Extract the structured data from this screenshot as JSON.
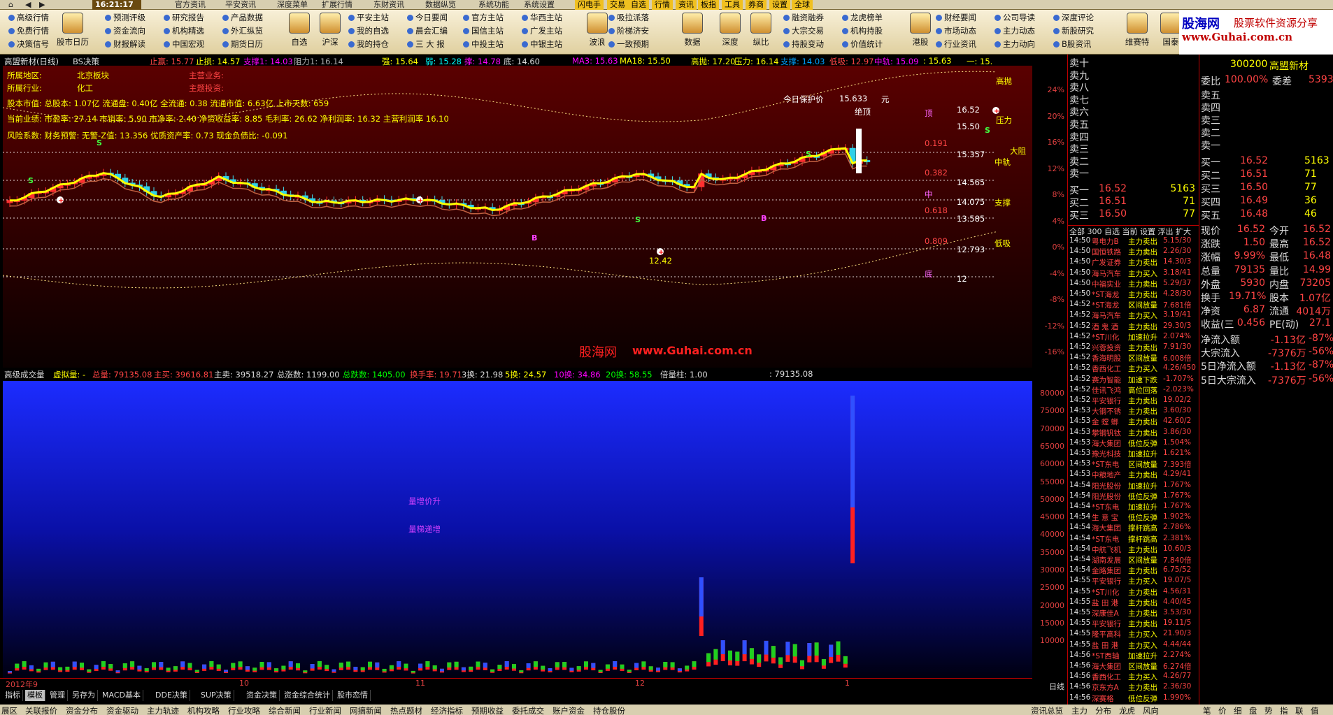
{
  "menu": {
    "clock": "16:21:17",
    "items": [
      "官方资讯",
      "平安资讯",
      "深度菜单",
      "扩展行情",
      "东财资讯",
      "数据纵览",
      "系统功能",
      "系统设置",
      "闪电手",
      "交易",
      "自选",
      "行情",
      "资讯",
      "板指",
      "工具",
      "券商",
      "设置",
      "全球"
    ]
  },
  "toolbar": {
    "cols": [
      {
        "items": [
          "高级行情",
          "免费行情",
          "决策信号"
        ]
      },
      {
        "items": [
          "预测评级",
          "资金流向",
          "财报解读"
        ]
      },
      {
        "items": [
          "研究报告",
          "机构精选",
          "中国宏观"
        ]
      },
      {
        "items": [
          "产品数据",
          "外汇纵览",
          "期货日历"
        ]
      },
      {
        "items": [
          "平安主站",
          "我的自选",
          "我的持仓"
        ]
      },
      {
        "items": [
          "今日要闻",
          "晨会汇编",
          "三 大 报"
        ]
      },
      {
        "items": [
          "官方主站",
          "国信主站",
          "中投主站"
        ]
      },
      {
        "items": [
          "华西主站",
          "广发主站",
          "中银主站"
        ]
      },
      {
        "items": [
          "吸拉派落",
          "阶梯济安",
          "一致预期"
        ]
      },
      {
        "items": [
          "融资融券",
          "大宗交易",
          "持股变动"
        ]
      },
      {
        "items": [
          "龙虎榜单",
          "机构持股",
          "价值统计"
        ]
      },
      {
        "items": [
          "财经要闻",
          "市场动态",
          "行业资讯"
        ]
      },
      {
        "items": [
          "公司导读",
          "主力动态",
          "主力动向"
        ]
      },
      {
        "items": [
          "深度评论",
          "新股研究",
          "B股资讯"
        ]
      }
    ],
    "bigs": [
      "股市日历",
      "自选",
      "沪深",
      "波浪",
      "数据",
      "深度",
      "纵比",
      "港股",
      "维赛特",
      "国泰"
    ],
    "extra": [
      "财经日历",
      "千股千评"
    ]
  },
  "brand": {
    "line1": "股海网",
    "line2": "股票软件资源分享",
    "line3": "www.Guhai.com.cn"
  },
  "infobar1": [
    {
      "t": "高盟新材(日线)",
      "c": "#dddddd"
    },
    {
      "t": "BS决策",
      "c": "#dddddd"
    },
    {
      "t": "止赢: 15.77",
      "c": "#ff4444"
    },
    {
      "t": "止损: 14.57",
      "c": "#ffff00"
    },
    {
      "t": "支撑1: 14.03",
      "c": "#ff00ff"
    },
    {
      "t": "阻力1: 16.14",
      "c": "#aaaaaa"
    },
    {
      "t": "强: 15.64",
      "c": "#ffff00"
    },
    {
      "t": "弱: 15.28",
      "c": "#00ffff"
    },
    {
      "t": "撑: 14.78",
      "c": "#ff00ff"
    },
    {
      "t": "底: 14.60",
      "c": "#dddddd"
    },
    {
      "t": "MA3: 15.63",
      "c": "#ff00ff"
    },
    {
      "t": "MA18: 15.50",
      "c": "#ffff00"
    },
    {
      "t": "高抛: 17.20",
      "c": "#ffff00"
    },
    {
      "t": "压力: 16.14",
      "c": "#ffff00"
    },
    {
      "t": "支撑: 14.03",
      "c": "#00a0ff"
    },
    {
      "t": "低吸: 12.97",
      "c": "#ff4444"
    },
    {
      "t": "中轨: 15.09",
      "c": "#ff00ff"
    },
    {
      "t": ": 15.63",
      "c": "#ffff00"
    },
    {
      "t": "一: 15.",
      "c": "#ffff00"
    }
  ],
  "fund": {
    "area_label": "所属地区:",
    "area": "北京板块",
    "business_label": "主营业务:",
    "industry_label": "所属行业:",
    "industry": "化工",
    "concept_label": "主题投资:",
    "line1": "股本市值: 总股本: 1.07亿 流通盘: 0.40亿 全流通: 0.38 流通市值: 6.63亿 上市天数: 659",
    "line2": "当前业绩: 市盈率: 27.14 市销率: 5.90 市净率: 2.40 净资收益率: 8.85 毛利率: 26.62 净利润率: 16.32 主营利润率 16.10",
    "line3": "风险系数: 财务预警: 无警-Z值: 13.356 优质资产率: 0.73 现金负债比: -0.091"
  },
  "protect": {
    "label": "今日保护价",
    "value": "15.633",
    "unit": "元",
    "note": "绝顶"
  },
  "chart_labels": {
    "gaopao": "高抛",
    "yali": "压力",
    "dazhu": "大阻",
    "zhonggui": "中轨",
    "zhicheng": "支撑",
    "dixi": "低吸",
    "ding": "顶",
    "zhong": "中",
    "di": "底",
    "low": "12.42",
    "levels": [
      "16.52",
      "15.50",
      "15.357",
      "14.565",
      "14.075",
      "13.585",
      "12.793",
      "12"
    ],
    "fibs": [
      "0.191",
      "0.382",
      "0.618",
      "0.809"
    ],
    "vol_notes": [
      "量增价升",
      "量梯递增"
    ]
  },
  "pct_axis": [
    "24%",
    "20%",
    "16%",
    "12%",
    "8%",
    "4%",
    "0%",
    "-4%",
    "-8%",
    "-12%",
    "-16%"
  ],
  "vol_axis": [
    "80000",
    "75000",
    "70000",
    "65000",
    "60000",
    "55000",
    "50000",
    "45000",
    "40000",
    "35000",
    "30000",
    "25000",
    "20000",
    "15000",
    "10000"
  ],
  "infobar2": [
    {
      "t": "高级成交量",
      "c": "#dddddd"
    },
    {
      "t": "虚拟量: -",
      "c": "#ffff00"
    },
    {
      "t": "总量: 79135.08",
      "c": "#ff4444"
    },
    {
      "t": "主买: 39616.81",
      "c": "#ff4444"
    },
    {
      "t": "主卖: 39518.27",
      "c": "#dddddd"
    },
    {
      "t": "总涨数: 1199.00",
      "c": "#dddddd"
    },
    {
      "t": "总跌数: 1405.00",
      "c": "#00ff00"
    },
    {
      "t": "换手率: 19.71",
      "c": "#ff4444"
    },
    {
      "t": "3换: 21.98",
      "c": "#dddddd"
    },
    {
      "t": "5换: 24.57",
      "c": "#ffff00"
    },
    {
      "t": "10换: 34.86",
      "c": "#ff00ff"
    },
    {
      "t": "20换: 58.55",
      "c": "#00ff00"
    },
    {
      "t": "倍量柱: 1.00",
      "c": "#dddddd"
    },
    {
      "t": ": 79135.08",
      "c": "#dddddd"
    }
  ],
  "xaxis": [
    "2012年9",
    "10",
    "11",
    "12",
    "1"
  ],
  "daily_label": "日线",
  "tabs": [
    "指标",
    "模板",
    "管理",
    "另存为",
    "MACD基本",
    "DDE决策",
    "SUP决策",
    "资金决策",
    "资金综合统计",
    "股市恋情"
  ],
  "status": [
    "展区",
    "关联报价",
    "资金分布",
    "资金驱动",
    "主力轨迹",
    "机构攻略",
    "行业攻略",
    "综合新闻",
    "行业新闻",
    "网摘新闻",
    "热点题材",
    "经济指标",
    "预期收益",
    "委托成交",
    "账户资金",
    "持仓股份",
    "资讯总览",
    "主力",
    "分布",
    "龙虎",
    "风向",
    "笔",
    "价",
    "细",
    "盘",
    "势",
    "指",
    "联",
    "值"
  ],
  "quote": {
    "sells": [
      "卖十",
      "卖九",
      "卖八",
      "卖七",
      "卖六",
      "卖五",
      "卖四",
      "卖三",
      "卖二",
      "卖一"
    ],
    "buys": [
      {
        "l": "买一",
        "p": "16.52",
        "v": "5163"
      },
      {
        "l": "买二",
        "p": "16.51",
        "v": "71"
      },
      {
        "l": "买三",
        "p": "16.50",
        "v": "77"
      }
    ],
    "tabs": "全部 300 自选 当前 设置 浮出 扩大",
    "ticks": [
      [
        "14:50",
        "粤电力B",
        "主力卖出",
        "5.15/30"
      ],
      [
        "14:50",
        "国恒铁路",
        "主力卖出",
        "2.26/30"
      ],
      [
        "14:50",
        "广发证券",
        "主力卖出",
        "14.30/3"
      ],
      [
        "14:50",
        "海马汽车",
        "主力买入",
        "3.18/41"
      ],
      [
        "14:50",
        "中福实业",
        "主力卖出",
        "5.29/37"
      ],
      [
        "14:50",
        "*ST海龙",
        "主力卖出",
        "4.28/30"
      ],
      [
        "14:52",
        "*ST海龙",
        "区间放量",
        "7.681倍"
      ],
      [
        "14:52",
        "海马汽车",
        "主力买入",
        "3.19/41"
      ],
      [
        "14:52",
        "酒 鬼 酒",
        "主力卖出",
        "29.30/3"
      ],
      [
        "14:52",
        "*ST川化",
        "加速拉升",
        "2.074%"
      ],
      [
        "14:52",
        "兴蓉投资",
        "主力卖出",
        "7.91/30"
      ],
      [
        "14:52",
        "香海明股",
        "区间放量",
        "6.008倍"
      ],
      [
        "14:52",
        "香西化工",
        "主力买入",
        "4.26/450"
      ],
      [
        "14:52",
        "赛为智能",
        "加速下跌",
        "-1.707%"
      ],
      [
        "14:52",
        "佳讯飞鸿",
        "高位回落",
        "-2.023%"
      ],
      [
        "14:52",
        "平安银行",
        "主力卖出",
        "19.02/2"
      ],
      [
        "14:53",
        "大钢不锈",
        "主力卖出",
        "3.60/30"
      ],
      [
        "14:53",
        "金 螳 螂",
        "主力卖出",
        "42.60/2"
      ],
      [
        "14:53",
        "攀钢钒钛",
        "主力卖出",
        "3.86/30"
      ],
      [
        "14:53",
        "海大集团",
        "低位反弹",
        "1.504%"
      ],
      [
        "14:53",
        "豫光科技",
        "加速拉升",
        "1.621%"
      ],
      [
        "14:53",
        "*ST东电",
        "区间放量",
        "7.393倍"
      ],
      [
        "14:53",
        "中粮地产",
        "主力卖出",
        "4.29/41"
      ],
      [
        "14:54",
        "阳光股份",
        "加速拉升",
        "1.767%"
      ],
      [
        "14:54",
        "阳光股份",
        "低位反弹",
        "1.767%"
      ],
      [
        "14:54",
        "*ST东电",
        "加速拉升",
        "1.767%"
      ],
      [
        "14:54",
        "生 意 宝",
        "低位反弹",
        "1.902%"
      ],
      [
        "14:54",
        "海大集团",
        "撑杆跳高",
        "2.786%"
      ],
      [
        "14:54",
        "*ST东电",
        "撑杆跳高",
        "2.381%"
      ],
      [
        "14:54",
        "中航飞机",
        "主力卖出",
        "10.60/3"
      ],
      [
        "14:54",
        "湖南发展",
        "区间放量",
        "7.840倍"
      ],
      [
        "14:54",
        "金路集团",
        "主力卖出",
        "6.75/52"
      ],
      [
        "14:55",
        "平安银行",
        "主力买入",
        "19.07/5"
      ],
      [
        "14:55",
        "*ST川化",
        "主力卖出",
        "4.56/31"
      ],
      [
        "14:55",
        "盐 田 港",
        "主力卖出",
        "4.40/45"
      ],
      [
        "14:55",
        "深康佳A",
        "主力卖出",
        "3.53/30"
      ],
      [
        "14:55",
        "平安银行",
        "主力卖出",
        "19.11/5"
      ],
      [
        "14:55",
        "隆平高科",
        "主力买入",
        "21.90/3"
      ],
      [
        "14:55",
        "盐 田 港",
        "主力买入",
        "4.44/44"
      ],
      [
        "14:56",
        "*ST西轴",
        "加速拉升",
        "2.274%"
      ],
      [
        "14:56",
        "海大集团",
        "区间放量",
        "6.274倍"
      ],
      [
        "14:56",
        "香西化工",
        "主力买入",
        "4.26/77"
      ],
      [
        "14:56",
        "京东方A",
        "主力卖出",
        "2.36/30"
      ],
      [
        "14:56",
        "深赛格",
        "低位反弹",
        "1.990%"
      ]
    ]
  },
  "panel": {
    "code": "300200",
    "name": "高盟新材",
    "webi_l": "委比",
    "webi": "100.00%",
    "wecha_l": "委差",
    "wecha": "5393",
    "sells": [
      "卖五",
      "卖四",
      "卖三",
      "卖二",
      "卖一"
    ],
    "buys": [
      {
        "l": "买一",
        "p": "16.52",
        "v": "5163"
      },
      {
        "l": "买二",
        "p": "16.51",
        "v": "71"
      },
      {
        "l": "买三",
        "p": "16.50",
        "v": "77"
      },
      {
        "l": "买四",
        "p": "16.49",
        "v": "36"
      },
      {
        "l": "买五",
        "p": "16.48",
        "v": "46"
      }
    ],
    "stats": [
      [
        "现价",
        "16.52",
        "今开",
        "16.52"
      ],
      [
        "涨跌",
        "1.50",
        "最高",
        "16.52"
      ],
      [
        "涨幅",
        "9.99%",
        "最低",
        "16.48"
      ],
      [
        "总量",
        "79135",
        "量比",
        "14.99"
      ],
      [
        "外盘",
        "5930",
        "内盘",
        "73205"
      ],
      [
        "换手",
        "19.71%",
        "股本",
        "1.07亿"
      ],
      [
        "净资",
        "6.87",
        "流通",
        "4014万"
      ],
      [
        "收益(三",
        "0.456",
        "PE(动)",
        "27.1"
      ]
    ],
    "flows": [
      [
        "净流入额",
        "-1.13亿",
        "-87%"
      ],
      [
        "大宗流入",
        "-7376万",
        "-56%"
      ],
      [
        "5日净流入额",
        "-1.13亿",
        "-87%"
      ],
      [
        "5日大宗流入",
        "-7376万",
        "-56%"
      ]
    ]
  }
}
